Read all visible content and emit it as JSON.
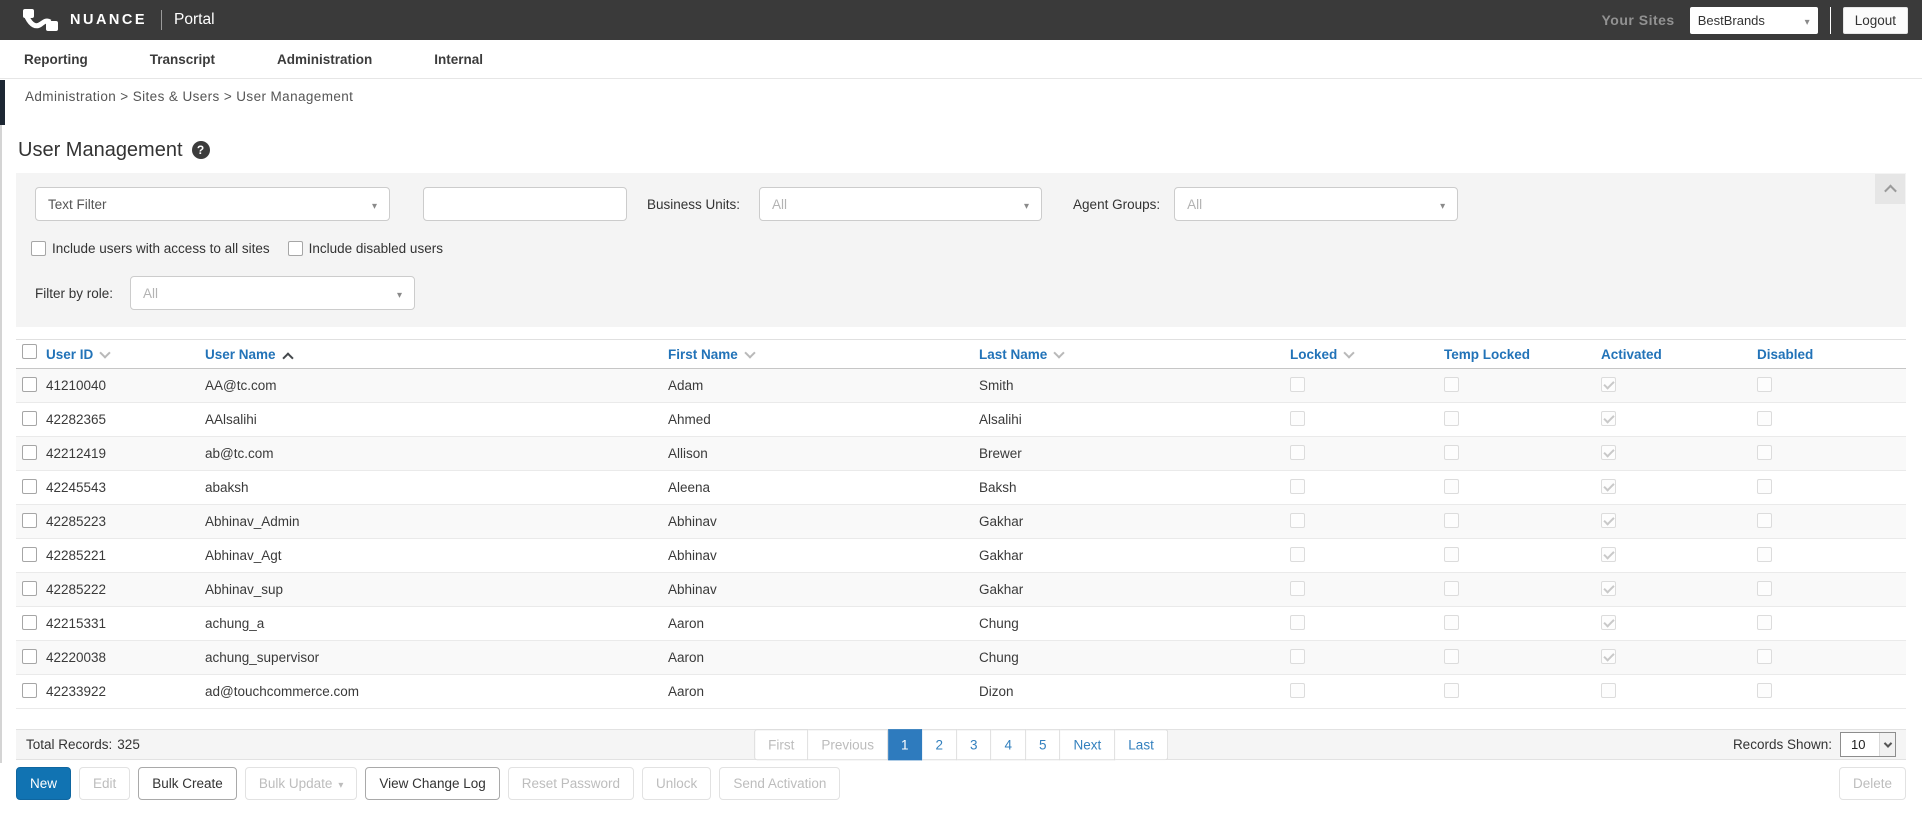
{
  "colors": {
    "header_bg": "#3a3a3a",
    "accent_blue": "#1173b2",
    "link_blue": "#2273b8",
    "pagination_active_bg": "#2e7bbe",
    "panel_bg": "#f4f4f4"
  },
  "header": {
    "brand": "NUANCE",
    "product": "Portal",
    "your_sites_label": "Your Sites",
    "site_selector": {
      "value": "BestBrands"
    },
    "logout_label": "Logout"
  },
  "nav": {
    "tabs": [
      {
        "label": "Reporting"
      },
      {
        "label": "Transcript"
      },
      {
        "label": "Administration"
      },
      {
        "label": "Internal"
      }
    ]
  },
  "breadcrumb": {
    "text": "Administration > Sites & Users > User Management"
  },
  "page": {
    "title": "User Management",
    "help_glyph": "?"
  },
  "filters": {
    "text_filter": {
      "value": "Text Filter"
    },
    "search_input": {
      "value": "",
      "placeholder": ""
    },
    "business_units": {
      "label": "Business Units:",
      "value": "All"
    },
    "agent_groups": {
      "label": "Agent Groups:",
      "value": "All"
    },
    "include_all_sites": {
      "label": "Include users with access to all sites",
      "checked": false
    },
    "include_disabled": {
      "label": "Include disabled users",
      "checked": false
    },
    "filter_by_role": {
      "label": "Filter by role:",
      "value": "All"
    }
  },
  "table": {
    "columns": [
      {
        "label": "User ID",
        "chevron": "down"
      },
      {
        "label": "User Name",
        "chevron": "up"
      },
      {
        "label": "First Name",
        "chevron": "down"
      },
      {
        "label": "Last Name",
        "chevron": "down"
      },
      {
        "label": "Locked",
        "chevron": "down"
      },
      {
        "label": "Temp Locked",
        "chevron": ""
      },
      {
        "label": "Activated",
        "chevron": ""
      },
      {
        "label": "Disabled",
        "chevron": ""
      }
    ],
    "rows": [
      {
        "user_id": "41210040",
        "user_name": "AA@tc.com",
        "first_name": "Adam",
        "last_name": "Smith",
        "locked": false,
        "temp_locked": false,
        "activated": true,
        "disabled": false
      },
      {
        "user_id": "42282365",
        "user_name": "AAlsalihi",
        "first_name": "Ahmed",
        "last_name": "Alsalihi",
        "locked": false,
        "temp_locked": false,
        "activated": true,
        "disabled": false
      },
      {
        "user_id": "42212419",
        "user_name": "ab@tc.com",
        "first_name": "Allison",
        "last_name": "Brewer",
        "locked": false,
        "temp_locked": false,
        "activated": true,
        "disabled": false
      },
      {
        "user_id": "42245543",
        "user_name": "abaksh",
        "first_name": "Aleena",
        "last_name": "Baksh",
        "locked": false,
        "temp_locked": false,
        "activated": true,
        "disabled": false
      },
      {
        "user_id": "42285223",
        "user_name": "Abhinav_Admin",
        "first_name": "Abhinav",
        "last_name": "Gakhar",
        "locked": false,
        "temp_locked": false,
        "activated": true,
        "disabled": false
      },
      {
        "user_id": "42285221",
        "user_name": "Abhinav_Agt",
        "first_name": "Abhinav",
        "last_name": "Gakhar",
        "locked": false,
        "temp_locked": false,
        "activated": true,
        "disabled": false
      },
      {
        "user_id": "42285222",
        "user_name": "Abhinav_sup",
        "first_name": "Abhinav",
        "last_name": "Gakhar",
        "locked": false,
        "temp_locked": false,
        "activated": true,
        "disabled": false
      },
      {
        "user_id": "42215331",
        "user_name": "achung_a",
        "first_name": "Aaron",
        "last_name": "Chung",
        "locked": false,
        "temp_locked": false,
        "activated": true,
        "disabled": false
      },
      {
        "user_id": "42220038",
        "user_name": "achung_supervisor",
        "first_name": "Aaron",
        "last_name": "Chung",
        "locked": false,
        "temp_locked": false,
        "activated": true,
        "disabled": false
      },
      {
        "user_id": "42233922",
        "user_name": "ad@touchcommerce.com",
        "first_name": "Aaron",
        "last_name": "Dizon",
        "locked": false,
        "temp_locked": false,
        "activated": false,
        "disabled": false
      }
    ]
  },
  "footer": {
    "total_records": {
      "label": "Total Records:",
      "value": "325"
    },
    "pagination": {
      "items": [
        {
          "label": "First",
          "state": "disabled"
        },
        {
          "label": "Previous",
          "state": "disabled"
        },
        {
          "label": "1",
          "state": "active"
        },
        {
          "label": "2",
          "state": ""
        },
        {
          "label": "3",
          "state": ""
        },
        {
          "label": "4",
          "state": ""
        },
        {
          "label": "5",
          "state": ""
        },
        {
          "label": "Next",
          "state": ""
        },
        {
          "label": "Last",
          "state": ""
        }
      ]
    },
    "records_shown": {
      "label": "Records Shown:",
      "value": "10"
    }
  },
  "actions": {
    "buttons": [
      {
        "label": "New",
        "style": "primary",
        "enabled": true,
        "caret": false
      },
      {
        "label": "Edit",
        "style": "default",
        "enabled": false,
        "caret": false
      },
      {
        "label": "Bulk Create",
        "style": "default",
        "enabled": true,
        "caret": false
      },
      {
        "label": "Bulk Update",
        "style": "default",
        "enabled": false,
        "caret": true
      },
      {
        "label": "View Change Log",
        "style": "default",
        "enabled": true,
        "caret": false
      },
      {
        "label": "Reset Password",
        "style": "default",
        "enabled": false,
        "caret": false
      },
      {
        "label": "Unlock",
        "style": "default",
        "enabled": false,
        "caret": false
      },
      {
        "label": "Send Activation",
        "style": "default",
        "enabled": false,
        "caret": false
      }
    ],
    "delete": {
      "label": "Delete",
      "enabled": false
    }
  }
}
